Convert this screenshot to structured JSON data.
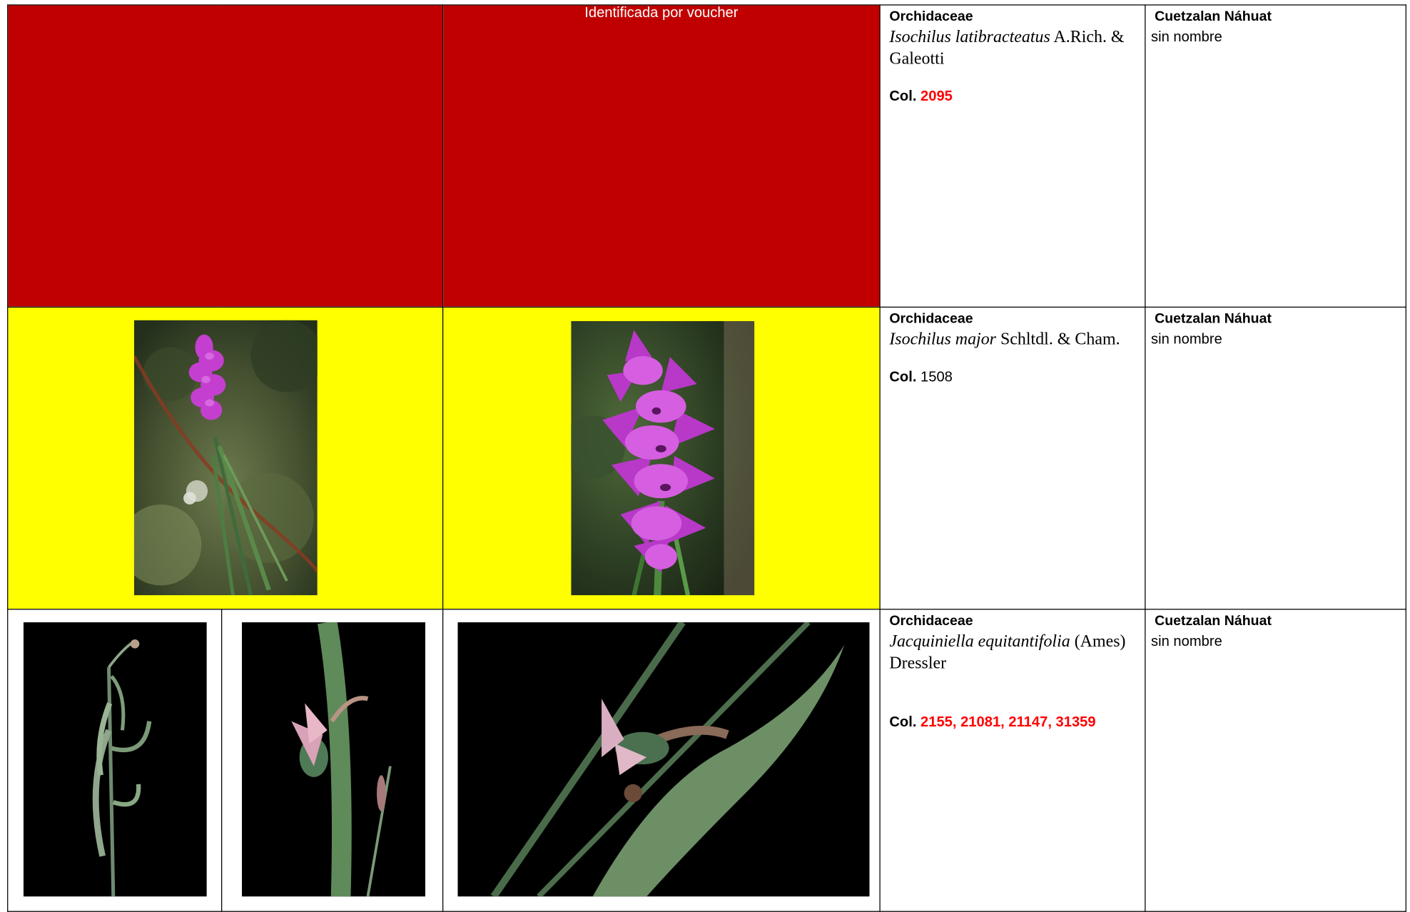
{
  "rows": [
    {
      "voucher_text": "Identificada por voucher",
      "family": "Orchidaceae",
      "species_italic": "Isochilus latibracteatus",
      "species_author": " A.Rich. & Galeotti",
      "col_label": "Col.",
      "col_numbers": "2095",
      "region": "Cuetzalan Náhuat",
      "local_name": "sin nombre"
    },
    {
      "family": "Orchidaceae",
      "species_italic": "Isochilus major",
      "species_author": " Schltdl. & Cham.",
      "col_label": "Col.",
      "col_numbers": "1508",
      "region": "Cuetzalan Náhuat",
      "local_name": "sin nombre"
    },
    {
      "family": "Orchidaceae",
      "species_italic": "Jacquiniella equitantifolia",
      "species_author": " (Ames) Dressler",
      "col_label": "Col.",
      "col_numbers": "2155, 21081, 21147, 31359",
      "region": "Cuetzalan Náhuat",
      "local_name": "sin nombre"
    }
  ],
  "colors": {
    "row1_background": "#c00000",
    "row2_background": "#ffff00",
    "collection_number_red": "#ff0000",
    "flower_magenta": "#c43fd0"
  },
  "icons": [
    "orchid-photo-habit",
    "orchid-photo-flower-closeup",
    "orchid-photo-plant-black-bg",
    "orchid-photo-flower-black-bg",
    "orchid-photo-leaf-black-bg"
  ]
}
